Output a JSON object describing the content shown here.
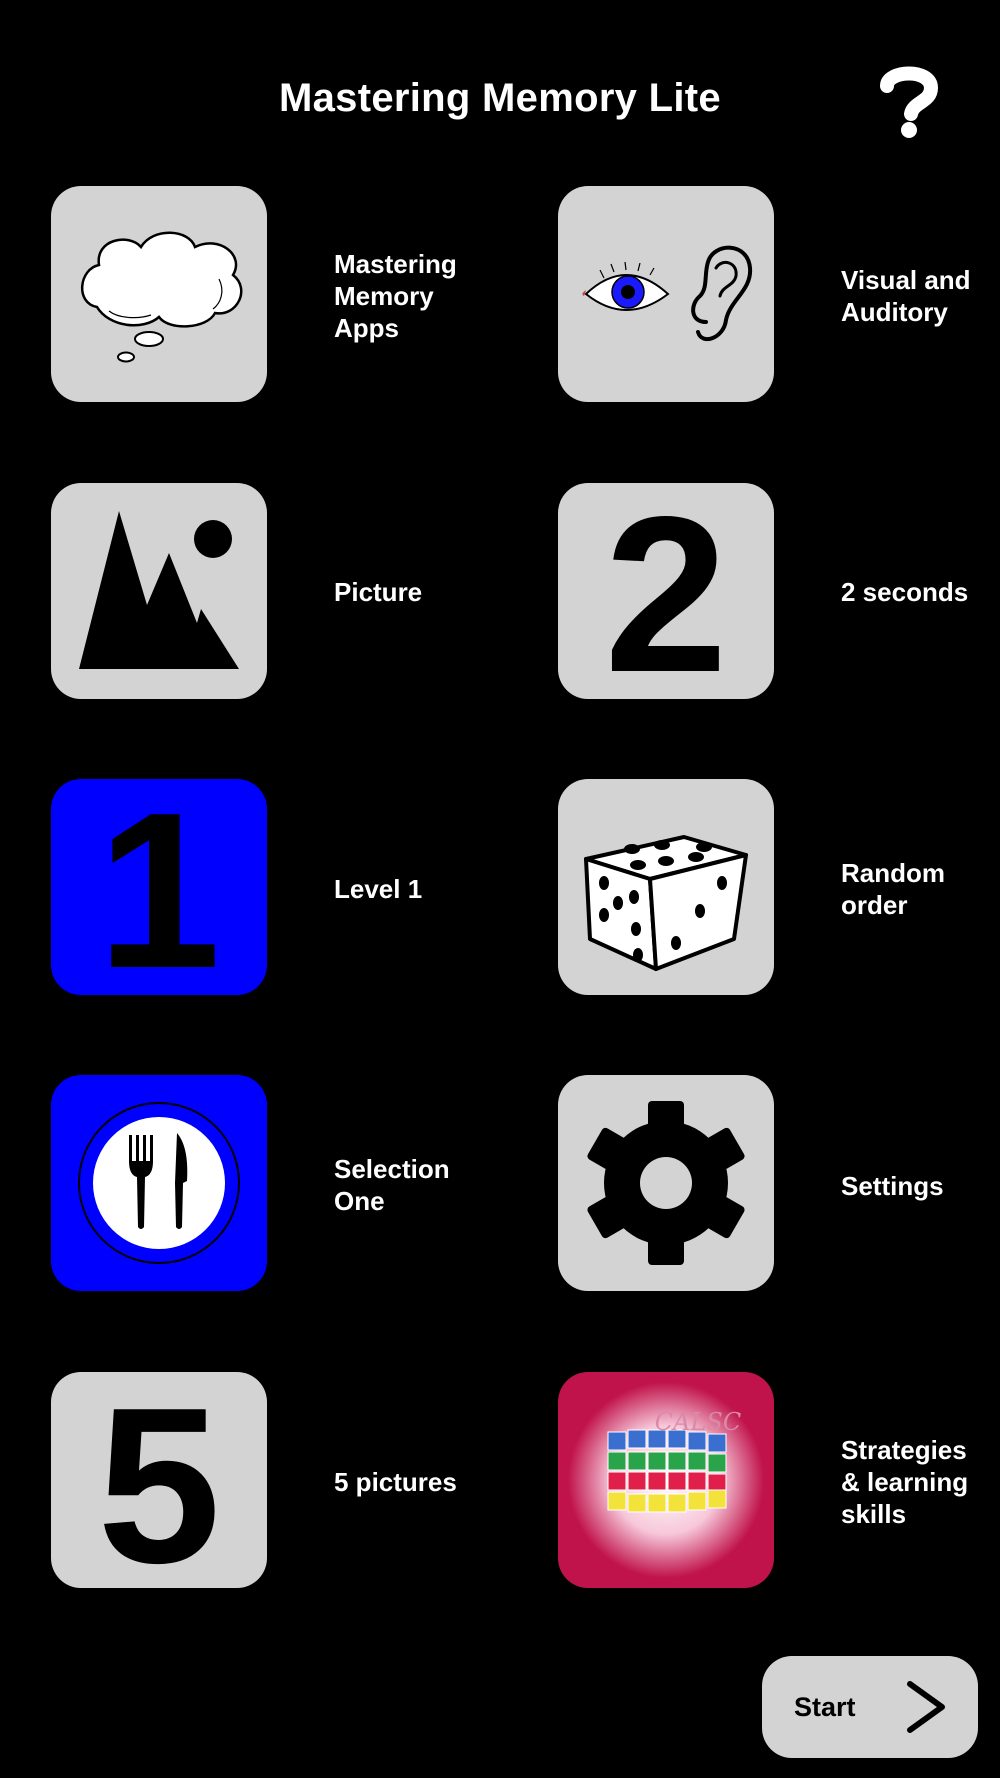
{
  "header": {
    "title": "Mastering Memory Lite",
    "help_icon": "question-mark-icon"
  },
  "options": [
    {
      "label": "Mastering\nMemory\nApps",
      "icon": "thought-bubble-icon",
      "tile_color": "#d3d3d3"
    },
    {
      "label": "Visual and\nAuditory",
      "icon": "eye-ear-icon",
      "tile_color": "#d3d3d3"
    },
    {
      "label": "Picture",
      "icon": "picture-icon",
      "tile_color": "#d3d3d3"
    },
    {
      "label": "2 seconds",
      "icon": "number-2-icon",
      "icon_text": "2",
      "tile_color": "#d3d3d3"
    },
    {
      "label": "Level 1",
      "icon": "number-1-icon",
      "icon_text": "1",
      "tile_color": "#0000ff"
    },
    {
      "label": "Random\norder",
      "icon": "dice-icon",
      "tile_color": "#d3d3d3"
    },
    {
      "label": "Selection\nOne",
      "icon": "plate-fork-knife-icon",
      "tile_color": "#0000ff"
    },
    {
      "label": "Settings",
      "icon": "gear-icon",
      "tile_color": "#d3d3d3"
    },
    {
      "label": "5 pictures",
      "icon": "number-5-icon",
      "icon_text": "5",
      "tile_color": "#d3d3d3"
    },
    {
      "label": "Strategies\n& learning\nskills",
      "icon": "calsc-logo-icon",
      "logo_text": "CALSC",
      "tile_color": "#c0134b"
    }
  ],
  "start_button": {
    "label": "Start",
    "icon": "chevron-right-icon"
  },
  "colors": {
    "background": "#000000",
    "tile_gray": "#d3d3d3",
    "tile_blue": "#0000ff",
    "tile_red": "#c0134b",
    "text": "#ffffff"
  }
}
